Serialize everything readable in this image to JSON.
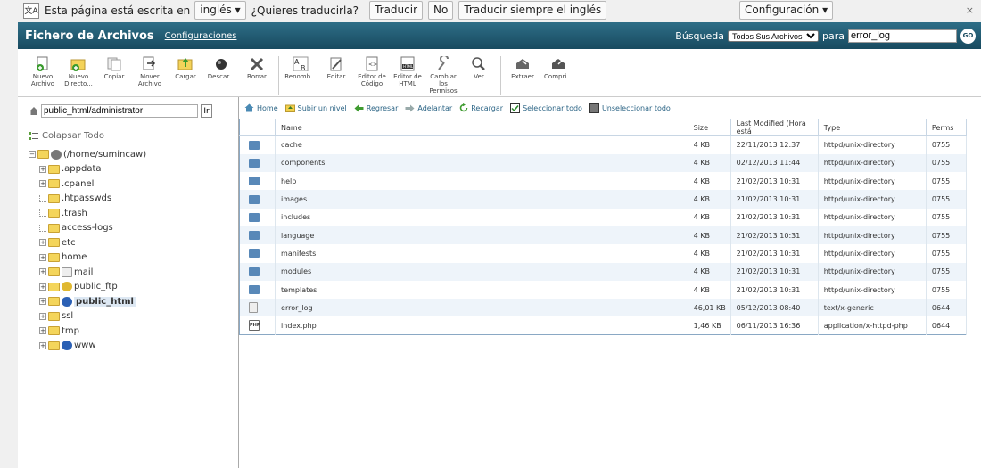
{
  "translate_bar": {
    "text": "Esta página está escrita en",
    "language": "inglés",
    "question": "¿Quieres traducirla?",
    "translate_button": "Traducir",
    "no_button": "No",
    "always_button": "Traducir siempre el inglés",
    "config_button": "Configuración",
    "close": "×"
  },
  "header": {
    "title": "Fichero de Archivos",
    "config_link": "Configuraciones",
    "search_label": "Búsqueda",
    "search_scope": "Todos Sus Archivos",
    "search_para": "para",
    "search_value": "error_log",
    "go_label": "GO"
  },
  "toolbar": [
    {
      "label": "Nuevo\nArchivo",
      "icon": "new-file-icon"
    },
    {
      "label": "Nuevo\nDirecto...",
      "icon": "new-folder-icon"
    },
    {
      "label": "Copiar",
      "icon": "copy-icon"
    },
    {
      "label": "Mover\nArchivo",
      "icon": "move-icon"
    },
    {
      "label": "Cargar",
      "icon": "upload-icon"
    },
    {
      "label": "Descar...",
      "icon": "download-icon"
    },
    {
      "label": "Borrar",
      "icon": "delete-icon"
    },
    {
      "label": "Renomb...",
      "icon": "rename-icon"
    },
    {
      "label": "Editar",
      "icon": "edit-icon"
    },
    {
      "label": "Editor de\nCódigo",
      "icon": "code-editor-icon"
    },
    {
      "label": "Editor de\nHTML",
      "icon": "html-editor-icon"
    },
    {
      "label": "Cambiar\nlos\nPermisos",
      "icon": "permissions-icon"
    },
    {
      "label": "Ver",
      "icon": "view-icon"
    },
    {
      "label": "Extraer",
      "icon": "extract-icon"
    },
    {
      "label": "Compri...",
      "icon": "compress-icon"
    }
  ],
  "left": {
    "path_value": "public_html/administrator",
    "go_button": "Ir",
    "collapse_all": "Colapsar Todo",
    "tree": [
      {
        "label": "(/home/sumincaw)",
        "indent": 0,
        "expander": "−",
        "icon": "home-icon"
      },
      {
        "label": ".appdata",
        "indent": 1,
        "expander": "+"
      },
      {
        "label": ".cpanel",
        "indent": 1,
        "expander": "+"
      },
      {
        "label": ".htpasswds",
        "indent": 1,
        "expander": ""
      },
      {
        "label": ".trash",
        "indent": 1,
        "expander": ""
      },
      {
        "label": "access-logs",
        "indent": 1,
        "expander": ""
      },
      {
        "label": "etc",
        "indent": 1,
        "expander": "+"
      },
      {
        "label": "home",
        "indent": 1,
        "expander": "+"
      },
      {
        "label": "mail",
        "indent": 1,
        "expander": "+",
        "icon": "mail-icon"
      },
      {
        "label": "public_ftp",
        "indent": 1,
        "expander": "+",
        "icon": "ftp-icon"
      },
      {
        "label": "public_html",
        "indent": 1,
        "expander": "+",
        "icon": "globe-icon",
        "selected": true
      },
      {
        "label": "ssl",
        "indent": 1,
        "expander": "+"
      },
      {
        "label": "tmp",
        "indent": 1,
        "expander": "+"
      },
      {
        "label": "www",
        "indent": 1,
        "expander": "+",
        "icon": "globe-icon"
      }
    ]
  },
  "nav": {
    "home": "Home",
    "up": "Subir un nivel",
    "back": "Regresar",
    "forward": "Adelantar",
    "reload": "Recargar",
    "select_all": "Seleccionar todo",
    "unselect_all": "Unseleccionar todo"
  },
  "table": {
    "headers": [
      "Name",
      "Size",
      "Last Modified (Hora está",
      "Type",
      "Perms"
    ],
    "rows": [
      {
        "name": "cache",
        "size": "4 KB",
        "modified": "22/11/2013 12:37",
        "type": "httpd/unix-directory",
        "perms": "0755",
        "kind": "dir"
      },
      {
        "name": "components",
        "size": "4 KB",
        "modified": "02/12/2013 11:44",
        "type": "httpd/unix-directory",
        "perms": "0755",
        "kind": "dir"
      },
      {
        "name": "help",
        "size": "4 KB",
        "modified": "21/02/2013 10:31",
        "type": "httpd/unix-directory",
        "perms": "0755",
        "kind": "dir"
      },
      {
        "name": "images",
        "size": "4 KB",
        "modified": "21/02/2013 10:31",
        "type": "httpd/unix-directory",
        "perms": "0755",
        "kind": "dir"
      },
      {
        "name": "includes",
        "size": "4 KB",
        "modified": "21/02/2013 10:31",
        "type": "httpd/unix-directory",
        "perms": "0755",
        "kind": "dir"
      },
      {
        "name": "language",
        "size": "4 KB",
        "modified": "21/02/2013 10:31",
        "type": "httpd/unix-directory",
        "perms": "0755",
        "kind": "dir"
      },
      {
        "name": "manifests",
        "size": "4 KB",
        "modified": "21/02/2013 10:31",
        "type": "httpd/unix-directory",
        "perms": "0755",
        "kind": "dir"
      },
      {
        "name": "modules",
        "size": "4 KB",
        "modified": "21/02/2013 10:31",
        "type": "httpd/unix-directory",
        "perms": "0755",
        "kind": "dir"
      },
      {
        "name": "templates",
        "size": "4 KB",
        "modified": "21/02/2013 10:31",
        "type": "httpd/unix-directory",
        "perms": "0755",
        "kind": "dir"
      },
      {
        "name": "error_log",
        "size": "46,01 KB",
        "modified": "05/12/2013 08:40",
        "type": "text/x-generic",
        "perms": "0644",
        "kind": "file"
      },
      {
        "name": "index.php",
        "size": "1,46 KB",
        "modified": "06/11/2013 16:36",
        "type": "application/x-httpd-php",
        "perms": "0644",
        "kind": "php"
      }
    ]
  }
}
